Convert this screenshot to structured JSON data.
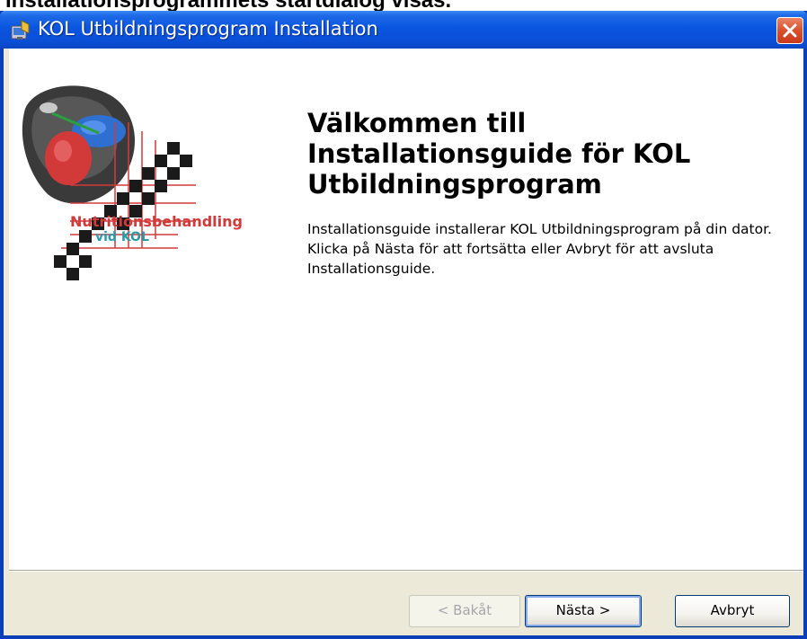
{
  "caption": "Installationsprogrammets startdialog visas.",
  "window": {
    "title": "KOL Utbildningsprogram Installation"
  },
  "logo": {
    "line1": "Nutritionsbehandling",
    "line2": "vid KOL",
    "colors": {
      "red": "#d23a3a",
      "teal": "#2a9aa8",
      "blue": "#2f6fd0"
    }
  },
  "content": {
    "heading": "Välkommen till Installationsguide för KOL Utbildningsprogram",
    "body": "Installationsguide installerar KOL Utbildningsprogram på din dator.  Klicka på Nästa för att fortsätta eller Avbryt för att avsluta Installationsguide."
  },
  "buttons": {
    "back": "< Bakåt",
    "next": "Nästa >",
    "cancel": "Avbryt"
  },
  "icons": {
    "title_icon": "installer-icon",
    "close_icon": "close-icon"
  },
  "colors": {
    "titlebar": "#0a55e0",
    "dialog_bg": "#ece9d8",
    "close": "#d8502c"
  }
}
